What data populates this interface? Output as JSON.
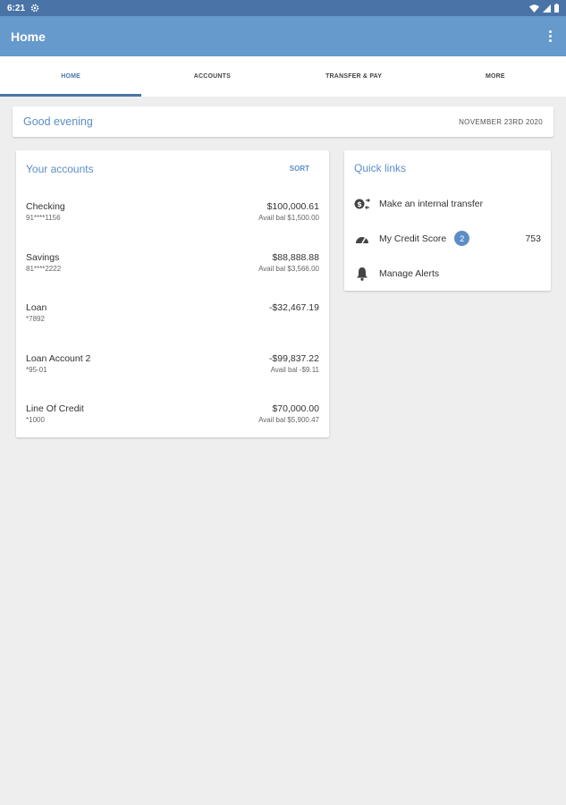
{
  "status_bar": {
    "time": "6:21"
  },
  "app_bar": {
    "title": "Home"
  },
  "tabs": [
    {
      "label": "HOME",
      "active": true
    },
    {
      "label": "ACCOUNTS",
      "active": false
    },
    {
      "label": "TRANSFER & PAY",
      "active": false
    },
    {
      "label": "MORE",
      "active": false
    }
  ],
  "greeting": {
    "text": "Good evening",
    "date": "NOVEMBER 23RD 2020"
  },
  "accounts": {
    "title": "Your accounts",
    "sort_label": "SORT",
    "items": [
      {
        "name": "Checking",
        "number": "91****1156",
        "balance": "$100,000.61",
        "available": "Avail bal $1,500.00"
      },
      {
        "name": "Savings",
        "number": "81****2222",
        "balance": "$88,888.88",
        "available": "Avail bal $3,566.00"
      },
      {
        "name": "Loan",
        "number": "*7892",
        "balance": "-$32,467.19",
        "available": ""
      },
      {
        "name": "Loan Account 2",
        "number": "*95-01",
        "balance": "-$99,837.22",
        "available": "Avail bal -$9.11"
      },
      {
        "name": "Line Of Credit",
        "number": "*1000",
        "balance": "$70,000.00",
        "available": "Avail bal $5,900.47"
      }
    ]
  },
  "quick_links": {
    "title": "Quick links",
    "items": [
      {
        "label": "Make an internal transfer",
        "icon": "transfer-icon"
      },
      {
        "label": "My Credit Score",
        "icon": "speedometer-icon",
        "badge": "2",
        "value": "753"
      },
      {
        "label": "Manage Alerts",
        "icon": "bell-icon"
      }
    ]
  },
  "colors": {
    "status_bar": "#4a74a8",
    "app_bar": "#6699cc",
    "accent": "#5b8ec6",
    "background": "#eeeeee"
  }
}
